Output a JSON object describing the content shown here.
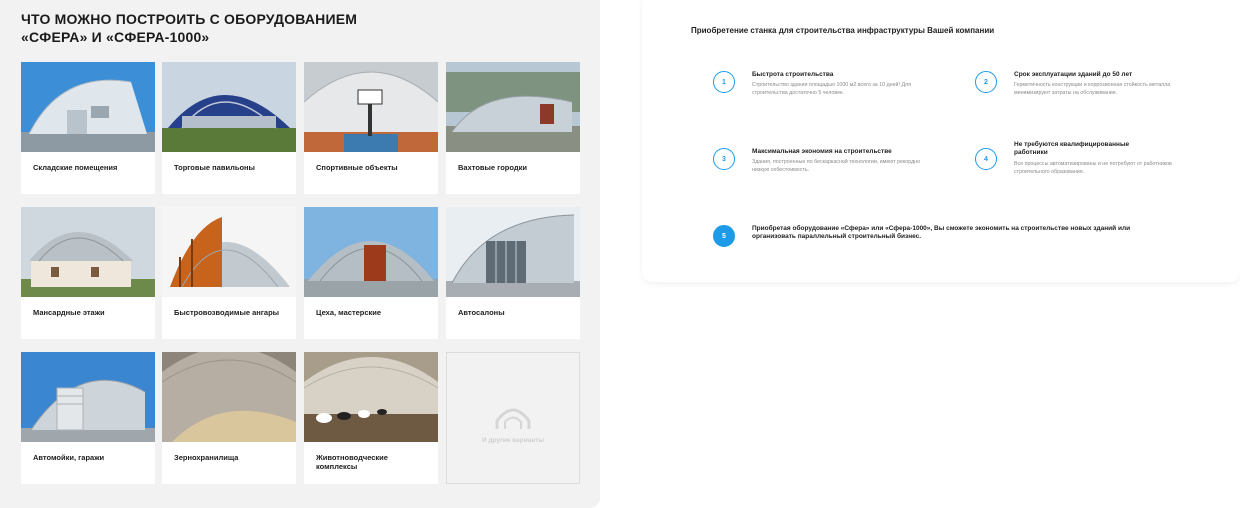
{
  "left": {
    "title": "ЧТО МОЖНО ПОСТРОИТЬ С ОБОРУДОВАНИЕМ «СФЕРА» И «СФЕРА-1000»",
    "cards": [
      {
        "label": "Складские помещения"
      },
      {
        "label": "Торговые павильоны"
      },
      {
        "label": "Спортивные объекты"
      },
      {
        "label": "Вахтовые городки"
      },
      {
        "label": "Мансардные этажи"
      },
      {
        "label": "Быстровозводимые ангары"
      },
      {
        "label": "Цеха, мастерские"
      },
      {
        "label": "Автосалоны"
      },
      {
        "label": "Автомойки, гаражи"
      },
      {
        "label": "Зернохранилища"
      },
      {
        "label": "Животноводческие комплексы"
      }
    ],
    "more_label": "И другие варианты"
  },
  "right": {
    "title": "Приобретение станка для строительства инфраструктуры Вашей компании",
    "features": [
      {
        "num": "1",
        "title": "Быстрота строительства",
        "desc": "Строительство здания площадью 1000 м2 всего за 10 дней! Для строительства достаточно 5 человек."
      },
      {
        "num": "2",
        "title": "Срок эксплуатации зданий до 50 лет",
        "desc": "Герметичность конструкции и коррозионная стойкость металла минимизируют затраты на обслуживание."
      },
      {
        "num": "3",
        "title": "Максимальная экономия на строительстве",
        "desc": "Здания, построенные по бескаркасной технологии, имеют рекордно низкую себестоимость."
      },
      {
        "num": "4",
        "title": "Не требуются квалифицированные работники",
        "desc": "Все процессы автоматизированы и не потребуют от работников строительного образования."
      },
      {
        "num": "5",
        "title": "Приобретая оборудование «Сфера» или «Сфера-1000», Вы сможете экономить на строительстве новых зданий или организовать параллельный строительный бизнес."
      }
    ]
  },
  "colors": {
    "accent": "#1e9be8",
    "panel_bg": "#f2f2f2"
  },
  "icons": {
    "more": "arch-building-icon"
  }
}
